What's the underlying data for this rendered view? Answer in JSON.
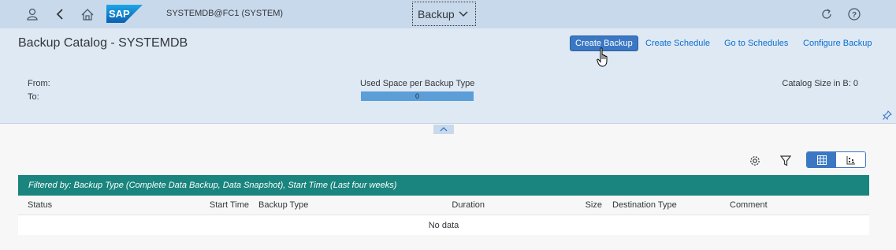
{
  "shell": {
    "system_title": "SYSTEMDB@FC1 (SYSTEM)",
    "app_menu_label": "Backup",
    "logo_text": "SAP"
  },
  "header": {
    "title": "Backup Catalog - SYSTEMDB",
    "actions": {
      "create_backup": "Create Backup",
      "create_schedule": "Create Schedule",
      "go_to_schedules": "Go to Schedules",
      "configure_backup": "Configure Backup"
    }
  },
  "summary": {
    "from_label": "From:",
    "to_label": "To:",
    "used_space_label": "Used Space per Backup Type",
    "used_space_value": "0",
    "catalog_size": "Catalog Size in B: 0"
  },
  "table": {
    "filter_text": "Filtered by: Backup Type (Complete Data Backup, Data Snapshot), Start Time (Last four weeks)",
    "columns": {
      "status": "Status",
      "start_time": "Start Time",
      "backup_type": "Backup Type",
      "duration": "Duration",
      "size": "Size",
      "destination_type": "Destination Type",
      "comment": "Comment"
    },
    "empty_text": "No data"
  },
  "colors": {
    "shellbar": "#c9d9ec",
    "header": "#dfe9f4",
    "primary_button": "#3b78c4",
    "filter_bar": "#1a847e",
    "link": "#0a6ed1"
  },
  "icons": [
    "user-icon",
    "back-icon",
    "home-icon",
    "sap-logo",
    "chevron-down-icon",
    "refresh-icon",
    "help-icon",
    "pin-icon",
    "collapse-up-icon",
    "settings-icon",
    "filter-icon",
    "table-view-icon",
    "chart-view-icon",
    "hand-cursor-icon"
  ]
}
